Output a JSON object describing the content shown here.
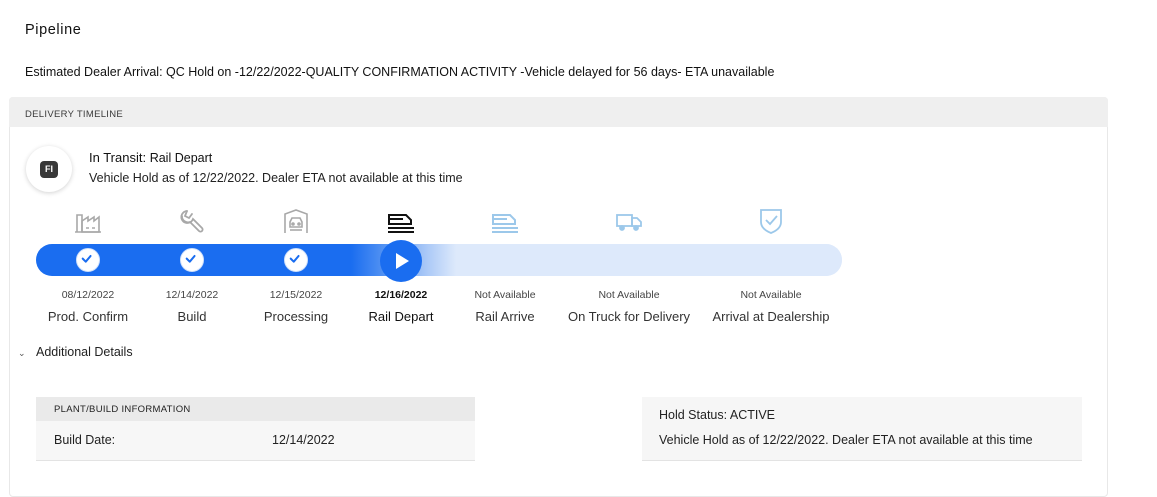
{
  "page": {
    "title": "Pipeline",
    "eta_line": "Estimated Dealer Arrival: QC Hold on -12/22/2022-QUALITY CONFIRMATION ACTIVITY -Vehicle delayed for 56 days- ETA unavailable"
  },
  "timeline_card": {
    "header": "DELIVERY TIMELINE",
    "badge": "FI",
    "status_prefix": "In Transit: ",
    "status_value": "Rail Depart",
    "status_detail": "Vehicle Hold as of 12/22/2022. Dealer ETA not available at this time",
    "stages": [
      {
        "name": "Prod. Confirm",
        "date": "08/12/2022",
        "state": "complete",
        "icon": "factory-icon"
      },
      {
        "name": "Build",
        "date": "12/14/2022",
        "state": "complete",
        "icon": "wrench-icon"
      },
      {
        "name": "Processing",
        "date": "12/15/2022",
        "state": "complete",
        "icon": "car-garage-icon"
      },
      {
        "name": "Rail Depart",
        "date": "12/16/2022",
        "state": "current",
        "icon": "rail-car-icon"
      },
      {
        "name": "Rail Arrive",
        "date": "Not Available",
        "state": "pending",
        "icon": "rail-car-icon"
      },
      {
        "name": "On Truck for Delivery",
        "date": "Not Available",
        "state": "pending",
        "icon": "truck-icon"
      },
      {
        "name": "Arrival at Dealership",
        "date": "Not Available",
        "state": "pending",
        "icon": "shield-check-icon"
      }
    ],
    "colors": {
      "progress": "#1a6df0",
      "track": "#dde9fb",
      "complete_icon": "#a8a8a8",
      "pending_icon": "#9cc8ea"
    }
  },
  "additional_details": {
    "toggle_label": "Additional Details",
    "plant_info": {
      "header": "PLANT/BUILD INFORMATION",
      "build_date_label": "Build Date:",
      "build_date_value": "12/14/2022"
    },
    "hold": {
      "status": "Hold Status: ACTIVE",
      "detail": "Vehicle Hold as of 12/22/2022. Dealer ETA not available at this time"
    }
  }
}
